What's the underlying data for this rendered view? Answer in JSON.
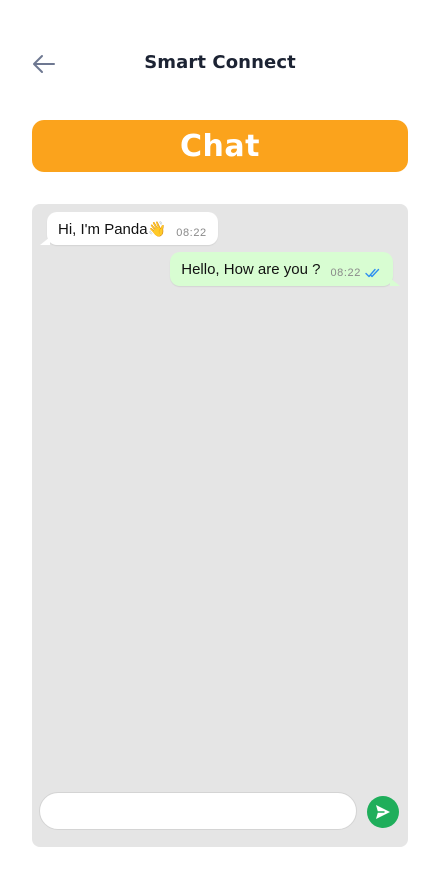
{
  "header": {
    "title": "Smart Connect",
    "back_icon": "arrow-left-icon"
  },
  "banner": {
    "label": "Chat",
    "color": "#fba31c"
  },
  "messages": [
    {
      "direction": "incoming",
      "text": "Hi, I'm Panda👋",
      "time": "08:22"
    },
    {
      "direction": "outgoing",
      "text": "Hello, How are you ?",
      "time": "08:22",
      "status_icon": "double-check-icon"
    }
  ],
  "composer": {
    "value": "",
    "placeholder": "",
    "send_icon": "send-icon",
    "send_color": "#1fae5b"
  },
  "colors": {
    "panel_bg": "#e5e5e5",
    "incoming_bubble": "#ffffff",
    "outgoing_bubble": "#d8fdd2",
    "tick_color": "#2f8ff0"
  }
}
